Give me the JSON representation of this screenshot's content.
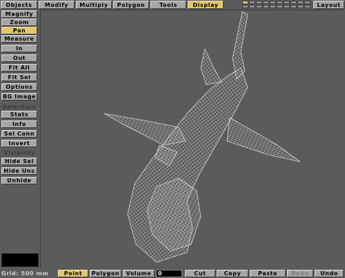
{
  "top_tabs": {
    "objects": "Objects",
    "modify": "Modify",
    "multiply": "Multiply",
    "polygon": "Polygon",
    "tools": "Tools",
    "display": "Display",
    "layout": "Layout"
  },
  "layers": {
    "active_index": 0
  },
  "left_panel": {
    "magnify": "Magnify",
    "zoom": "Zoom",
    "pan": "Pan",
    "measure": "Measure",
    "in": "In",
    "out": "Out",
    "fit_all": "Fit All",
    "fit_sel": "Fit Sel",
    "options": "Options",
    "bg_image": "BG Image",
    "selection_label": "Selection",
    "stats": "Stats",
    "info": "Info",
    "sel_conn": "Sel Conn",
    "invert": "Invert",
    "visibility_label": "Visibility",
    "hide_sel": "Hide Sel",
    "hide_uns": "Hide Uns",
    "unhide": "Unhide"
  },
  "bottom_bar": {
    "grid": "Grid: 500 mm",
    "point": "Point",
    "polygon": "Polygon",
    "volume": "Volume",
    "volume_value": "0",
    "cut": "Cut",
    "copy": "Copy",
    "paste": "Paste",
    "redo": "Redo",
    "undo": "Undo"
  },
  "colors": {
    "background": "#5b5b5b",
    "button": "#a6a6a6",
    "active": "#e3c86a",
    "wireframe": "#cfcfcf"
  },
  "icons": {
    "viewport-model": "shark-wireframe"
  }
}
